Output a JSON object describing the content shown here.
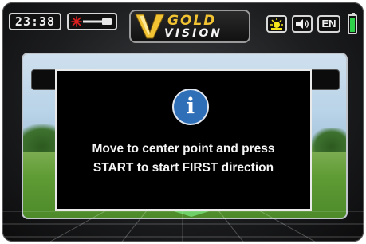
{
  "statusbar": {
    "time": "23:38",
    "pinpoint_icon": "pinpoint-icon",
    "brightness_icon": "sun-icon",
    "sound_icon": "speaker-icon",
    "language": "EN",
    "battery_icon": "battery-icon",
    "battery_level": 0.85
  },
  "logo": {
    "word1": "GOLD",
    "word2": "VISION",
    "gold_color": "#f1c232"
  },
  "dialog": {
    "icon": "info-icon",
    "line1": "Move to center point and press",
    "line2": "START to start FIRST direction"
  },
  "colors": {
    "accent_blue": "#2f6fb8",
    "battery_green": "#2fd04a",
    "indicator_green": "#6fd06a"
  }
}
